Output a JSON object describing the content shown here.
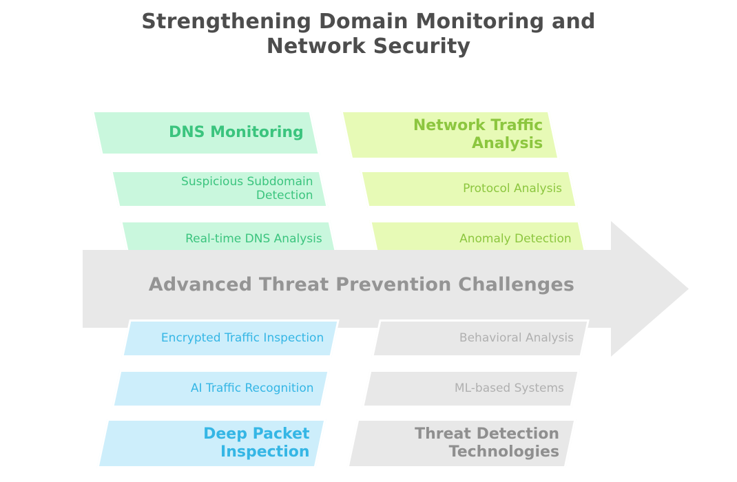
{
  "title": {
    "line1": "Strengthening Domain Monitoring and",
    "line2": "Network Security"
  },
  "center_arrow": {
    "label": "Advanced Threat Prevention Challenges",
    "fill_color": "#e8e8e8",
    "text_color": "#949494",
    "direction": "right"
  },
  "columns": [
    {
      "id": "dns-monitoring",
      "position": "top-left",
      "fill_color": "#c9f7dd",
      "text_color": "#3bc47e",
      "heading": "DNS Monitoring",
      "items": [
        "Suspicious Subdomain\nDetection",
        "Real-time DNS Analysis"
      ]
    },
    {
      "id": "network-traffic-analysis",
      "position": "top-right",
      "fill_color": "#e7fab6",
      "text_color": "#8cc63f",
      "heading": "Network Traffic\nAnalysis",
      "items": [
        "Protocol Analysis",
        "Anomaly Detection"
      ]
    },
    {
      "id": "deep-packet-inspection",
      "position": "bottom-left",
      "fill_color": "#cdeefb",
      "text_color": "#35b6e5",
      "heading": "Deep Packet\nInspection",
      "items": [
        "Encrypted Traffic Inspection",
        "AI Traffic Recognition"
      ]
    },
    {
      "id": "threat-detection-technologies",
      "position": "bottom-right",
      "fill_color": "#e8e8e8",
      "text_color": "#8f8f8f",
      "heading": "Threat Detection\nTechnologies",
      "items": [
        "Behavioral Analysis",
        "ML-based Systems"
      ]
    }
  ]
}
